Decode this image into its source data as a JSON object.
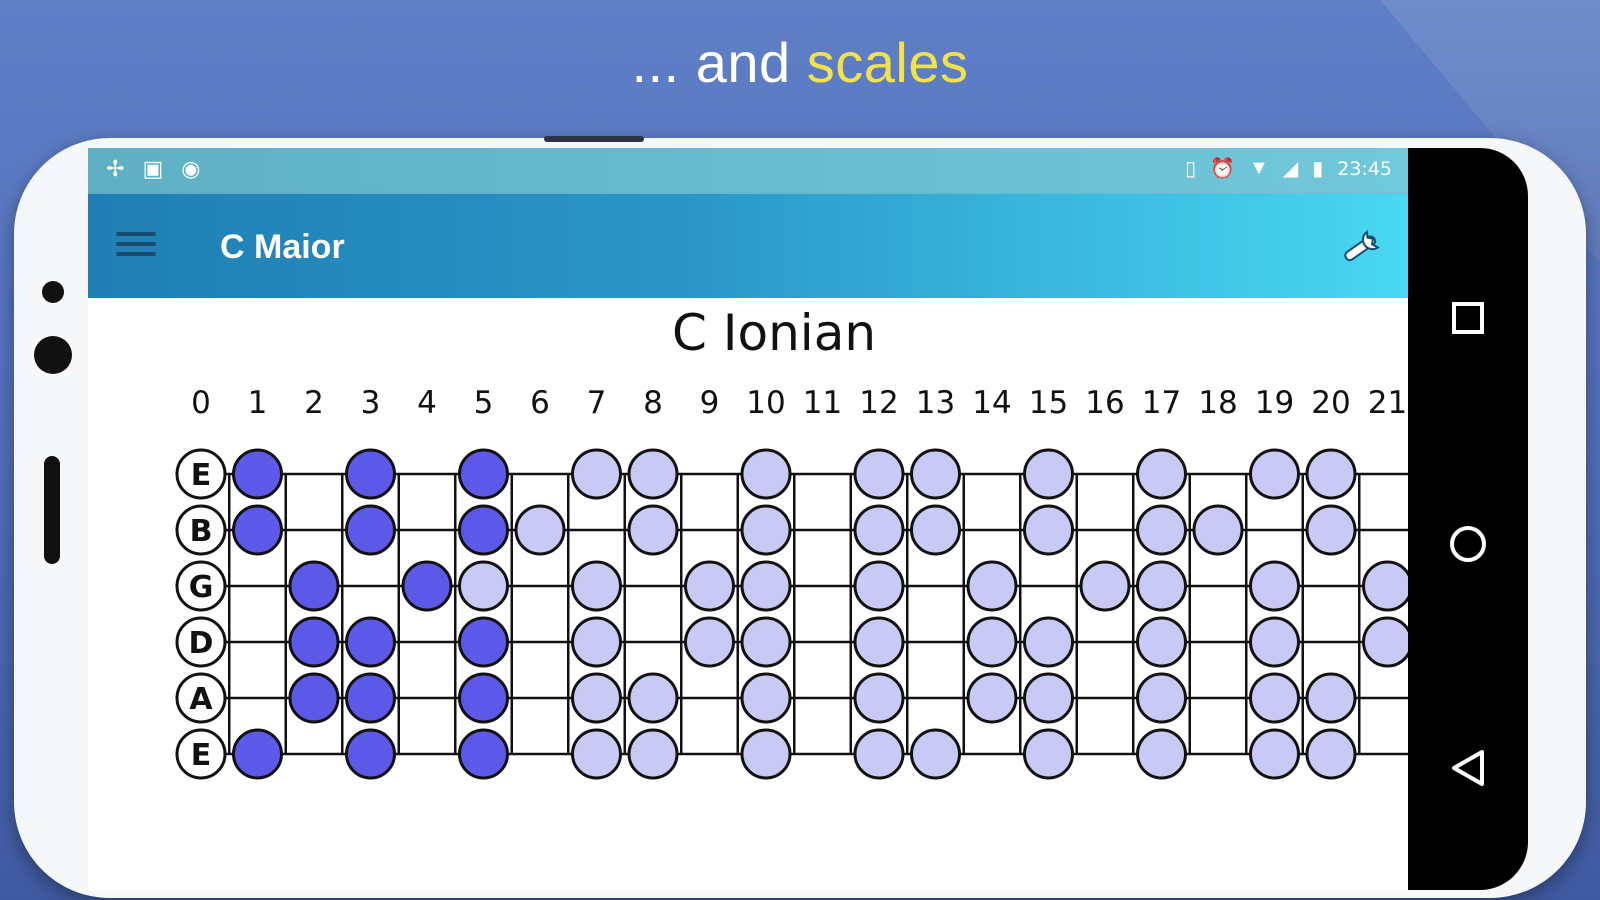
{
  "headline": {
    "prefix": "... and",
    "highlight": "scales"
  },
  "status_bar": {
    "time": "23:45"
  },
  "app_bar": {
    "title": "C Maior"
  },
  "fretboard": {
    "title": "C Ionian",
    "fret_numbers": [
      "0",
      "1",
      "2",
      "3",
      "4",
      "5",
      "6",
      "7",
      "8",
      "9",
      "10",
      "11",
      "12",
      "13",
      "14",
      "15",
      "16",
      "17",
      "18",
      "19",
      "20",
      "21"
    ],
    "strings": [
      "E",
      "B",
      "G",
      "D",
      "A",
      "E"
    ],
    "colors": {
      "primary_note": "#5c58e8",
      "scale_note": "#c9c9f6",
      "outline": "#111111"
    },
    "notes": [
      {
        "s": 0,
        "f": 1,
        "p": true
      },
      {
        "s": 0,
        "f": 3,
        "p": true
      },
      {
        "s": 0,
        "f": 5,
        "p": true
      },
      {
        "s": 0,
        "f": 7
      },
      {
        "s": 0,
        "f": 8
      },
      {
        "s": 0,
        "f": 10
      },
      {
        "s": 0,
        "f": 12
      },
      {
        "s": 0,
        "f": 13
      },
      {
        "s": 0,
        "f": 15
      },
      {
        "s": 0,
        "f": 17
      },
      {
        "s": 0,
        "f": 19
      },
      {
        "s": 0,
        "f": 20
      },
      {
        "s": 1,
        "f": 1,
        "p": true
      },
      {
        "s": 1,
        "f": 3,
        "p": true
      },
      {
        "s": 1,
        "f": 5,
        "p": true
      },
      {
        "s": 1,
        "f": 6
      },
      {
        "s": 1,
        "f": 8
      },
      {
        "s": 1,
        "f": 10
      },
      {
        "s": 1,
        "f": 12
      },
      {
        "s": 1,
        "f": 13
      },
      {
        "s": 1,
        "f": 15
      },
      {
        "s": 1,
        "f": 17
      },
      {
        "s": 1,
        "f": 18
      },
      {
        "s": 1,
        "f": 20
      },
      {
        "s": 2,
        "f": 2,
        "p": true
      },
      {
        "s": 2,
        "f": 4,
        "p": true
      },
      {
        "s": 2,
        "f": 5
      },
      {
        "s": 2,
        "f": 7
      },
      {
        "s": 2,
        "f": 9
      },
      {
        "s": 2,
        "f": 10
      },
      {
        "s": 2,
        "f": 12
      },
      {
        "s": 2,
        "f": 14
      },
      {
        "s": 2,
        "f": 16
      },
      {
        "s": 2,
        "f": 17
      },
      {
        "s": 2,
        "f": 19
      },
      {
        "s": 2,
        "f": 21
      },
      {
        "s": 3,
        "f": 2,
        "p": true
      },
      {
        "s": 3,
        "f": 3,
        "p": true
      },
      {
        "s": 3,
        "f": 5,
        "p": true
      },
      {
        "s": 3,
        "f": 7
      },
      {
        "s": 3,
        "f": 9
      },
      {
        "s": 3,
        "f": 10
      },
      {
        "s": 3,
        "f": 12
      },
      {
        "s": 3,
        "f": 14
      },
      {
        "s": 3,
        "f": 15
      },
      {
        "s": 3,
        "f": 17
      },
      {
        "s": 3,
        "f": 19
      },
      {
        "s": 3,
        "f": 21
      },
      {
        "s": 4,
        "f": 2,
        "p": true
      },
      {
        "s": 4,
        "f": 3,
        "p": true
      },
      {
        "s": 4,
        "f": 5,
        "p": true
      },
      {
        "s": 4,
        "f": 7
      },
      {
        "s": 4,
        "f": 8
      },
      {
        "s": 4,
        "f": 10
      },
      {
        "s": 4,
        "f": 12
      },
      {
        "s": 4,
        "f": 14
      },
      {
        "s": 4,
        "f": 15
      },
      {
        "s": 4,
        "f": 17
      },
      {
        "s": 4,
        "f": 19
      },
      {
        "s": 4,
        "f": 20
      },
      {
        "s": 5,
        "f": 1,
        "p": true
      },
      {
        "s": 5,
        "f": 3,
        "p": true
      },
      {
        "s": 5,
        "f": 5,
        "p": true
      },
      {
        "s": 5,
        "f": 7
      },
      {
        "s": 5,
        "f": 8
      },
      {
        "s": 5,
        "f": 10
      },
      {
        "s": 5,
        "f": 12
      },
      {
        "s": 5,
        "f": 13
      },
      {
        "s": 5,
        "f": 15
      },
      {
        "s": 5,
        "f": 17
      },
      {
        "s": 5,
        "f": 19
      },
      {
        "s": 5,
        "f": 20
      }
    ]
  }
}
